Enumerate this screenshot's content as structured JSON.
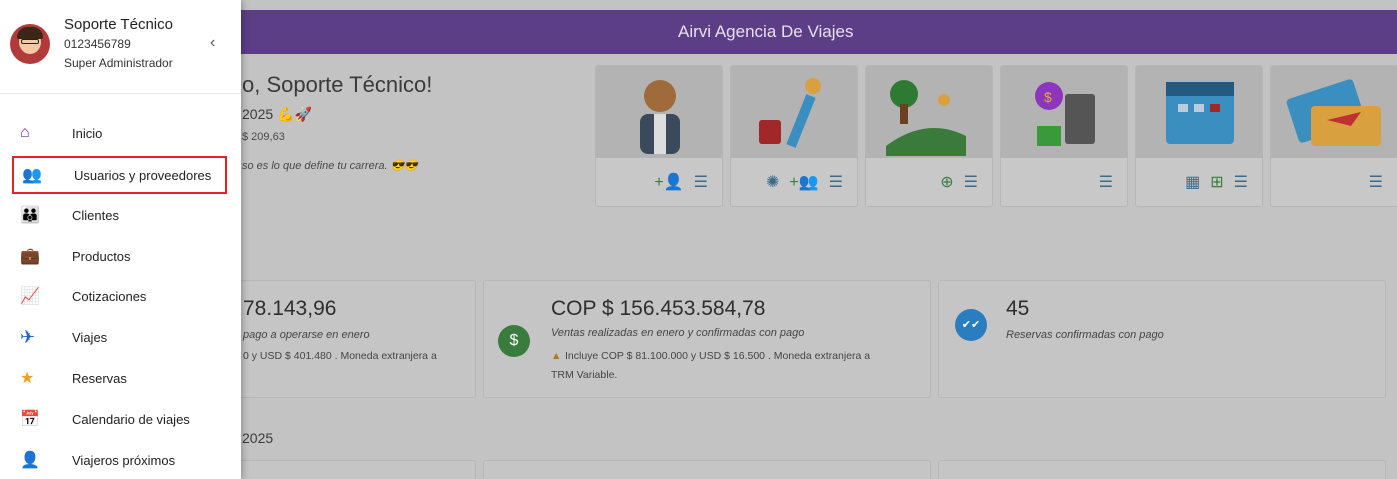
{
  "header": {
    "title": "Airvi Agencia De Viajes"
  },
  "welcome": {
    "greeting": "o, Soporte Técnico!",
    "date": "2025 💪🚀",
    "rate": "$ 209,63",
    "quote": "so es lo que define tu carrera. 😎😎"
  },
  "cards": [
    {
      "icon": "agent-icon",
      "actions": [
        "add-user-icon",
        "list-icon"
      ]
    },
    {
      "icon": "traveler-icon",
      "actions": [
        "discount-icon",
        "add-group-icon",
        "list-icon"
      ]
    },
    {
      "icon": "landscape-icon",
      "actions": [
        "add-circle-icon",
        "list-icon"
      ]
    },
    {
      "icon": "calculator-icon",
      "actions": [
        "list-icon"
      ]
    },
    {
      "icon": "calendar-icon",
      "actions": [
        "calendar-view-icon",
        "calendar-add-icon",
        "list-icon"
      ]
    },
    {
      "icon": "ticket-icon",
      "actions": [
        "list-icon"
      ]
    }
  ],
  "stats": {
    "first": {
      "amount": "78.143,96",
      "desc": "pago a operarse en enero",
      "note": "0 y USD $ 401.480 . Moneda extranjera a"
    },
    "second": {
      "amount": "COP $ 156.453.584,78",
      "desc": "Ventas realizadas en enero y confirmadas con pago",
      "note_line1": "Incluye COP $ 81.100.000 y USD $ 16.500 . Moneda extranjera a",
      "note_line2": "TRM Variable.",
      "icon_symbol": "$",
      "warn_symbol": "▲"
    },
    "third": {
      "amount": "45",
      "desc": "Reservas confirmadas con pago",
      "icon_symbol": "✔✔"
    }
  },
  "month_label": "2025",
  "user": {
    "name": "Soporte Técnico",
    "phone": "0123456789",
    "role": "Super Administrador"
  },
  "drawer": {
    "collapse_symbol": "‹",
    "items": [
      {
        "label": "Inicio",
        "icon": "home-icon",
        "symbol": "⌂",
        "color": "#6a2ca0"
      },
      {
        "label": "Usuarios y proveedores",
        "icon": "users-icon",
        "symbol": "👥",
        "color": "#e0357a"
      },
      {
        "label": "Clientes",
        "icon": "clients-icon",
        "symbol": "👪",
        "color": "#2d8ee6"
      },
      {
        "label": "Productos",
        "icon": "briefcase-icon",
        "symbol": "💼",
        "color": "#3aa24a"
      },
      {
        "label": "Cotizaciones",
        "icon": "quote-icon",
        "symbol": "📈",
        "color": "#8e35c0"
      },
      {
        "label": "Viajes",
        "icon": "plane-icon",
        "symbol": "✈",
        "color": "#1e64c8"
      },
      {
        "label": "Reservas",
        "icon": "star-ticket-icon",
        "symbol": "★",
        "color": "#f0a020"
      },
      {
        "label": "Calendario de viajes",
        "icon": "calendar-check-icon",
        "symbol": "📅",
        "color": "#2d8ee6"
      },
      {
        "label": "Viajeros próximos",
        "icon": "travelers-icon",
        "symbol": "👤",
        "color": "#666666"
      }
    ]
  },
  "colors": {
    "topbar": "#5c3e86",
    "active_outline": "#e02424",
    "stat_green": "#3a7c3d",
    "stat_blue": "#2a7ec0"
  }
}
